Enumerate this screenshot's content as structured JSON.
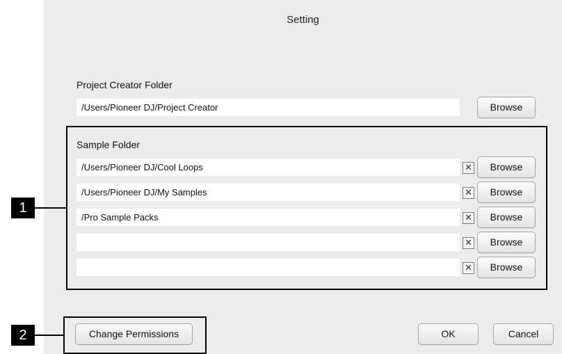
{
  "dialog": {
    "title": "Setting"
  },
  "project_creator": {
    "label": "Project Creator Folder",
    "path": "/Users/Pioneer DJ/Project Creator",
    "browse_label": "Browse"
  },
  "sample_folder": {
    "label": "Sample Folder",
    "rows": [
      {
        "path": "/Users/Pioneer DJ/Cool Loops",
        "clear_glyph": "✕",
        "browse_label": "Browse"
      },
      {
        "path": "/Users/Pioneer DJ/My Samples",
        "clear_glyph": "✕",
        "browse_label": "Browse"
      },
      {
        "path": "/Pro Sample Packs",
        "clear_glyph": "✕",
        "browse_label": "Browse"
      },
      {
        "path": "",
        "clear_glyph": "✕",
        "browse_label": "Browse"
      },
      {
        "path": "",
        "clear_glyph": "✕",
        "browse_label": "Browse"
      }
    ]
  },
  "footer": {
    "change_permissions_label": "Change Permissions",
    "ok_label": "OK",
    "cancel_label": "Cancel"
  },
  "callouts": {
    "one": "1",
    "two": "2"
  },
  "icons": {
    "clear": "clear-x-icon"
  }
}
